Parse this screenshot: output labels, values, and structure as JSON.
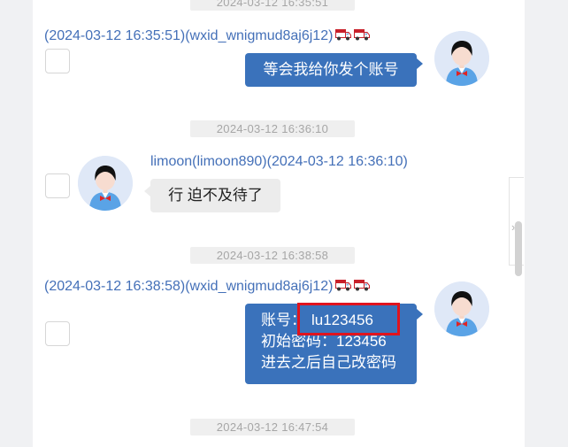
{
  "timestamps": {
    "top": "2024-03-12 16:35:51",
    "t2": "2024-03-12 16:36:10",
    "t3": "2024-03-12 16:38:58",
    "t4": "2024-03-12 16:47:54"
  },
  "messages": {
    "m1": {
      "header": "(2024-03-12 16:35:51)(wxid_wnigmud8aj6j12)",
      "text": "等会我给你发个账号"
    },
    "m2": {
      "header": "limoon(limoon890)(2024-03-12 16:36:10)",
      "text": "行 迫不及待了"
    },
    "m3": {
      "header": "(2024-03-12 16:38:58)(wxid_wnigmud8aj6j12)",
      "lines": {
        "account_label": "账号：",
        "account_value": "lu123456",
        "password_line": "初始密码：123456",
        "note_line": "进去之后自己改密码"
      }
    }
  },
  "icons": {
    "badge": "truck-icon",
    "avatar": "user-avatar-icon",
    "scroll": "double-chevron-right-icon"
  },
  "colors": {
    "sender_blue": "#4470b8",
    "bubble_blue": "#3a72bb",
    "bubble_gray": "#ececec",
    "highlight": "#e0141e"
  },
  "scroll_glyph": "»"
}
